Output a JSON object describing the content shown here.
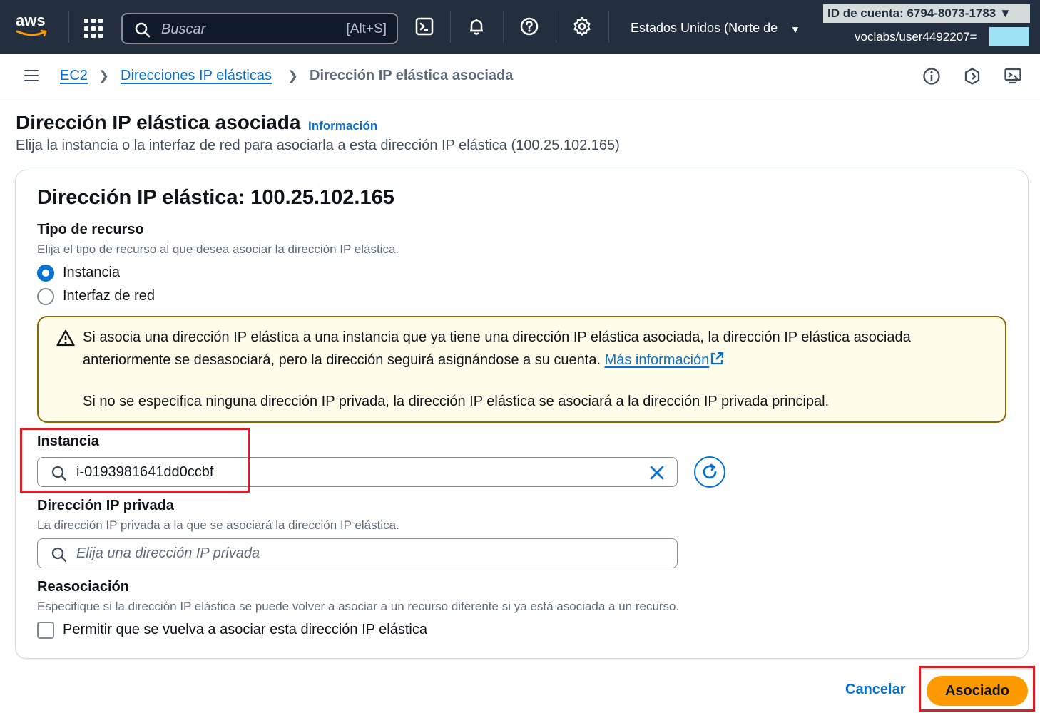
{
  "nav": {
    "logo": "aws",
    "search_placeholder": "Buscar",
    "search_shortcut": "[Alt+S]",
    "region": "Estados Unidos (Norte de",
    "account_id": "ID de cuenta: 6794-8073-1783 ▼",
    "user": "voclabs/user4492207="
  },
  "breadcrumb": {
    "items": [
      {
        "label": "EC2"
      },
      {
        "label": "Direcciones IP elásticas"
      },
      {
        "label": "Dirección IP elástica asociada"
      }
    ]
  },
  "header": {
    "title": "Dirección IP elástica asociada",
    "info": "Información",
    "subtitle": "Elija la instancia o la interfaz de red para asociarla a esta dirección IP elástica (100.25.102.165)"
  },
  "panel": {
    "title": "Dirección IP elástica: 100.25.102.165",
    "resource_type": {
      "label": "Tipo de recurso",
      "description": "Elija el tipo de recurso al que desea asociar la dirección IP elástica.",
      "options": [
        {
          "label": "Instancia",
          "selected": true
        },
        {
          "label": "Interfaz de red",
          "selected": false
        }
      ]
    },
    "alert": {
      "line1": "Si asocia una dirección IP elástica a una instancia que ya tiene una dirección IP elástica asociada, la dirección IP elástica asociada",
      "line2": "anteriormente se desasociará, pero la dirección seguirá asignándose a su cuenta.",
      "link": "Más información",
      "line3": "Si no se especifica ninguna dirección IP privada, la dirección IP elástica se asociará a la dirección IP privada principal."
    },
    "instance": {
      "label": "Instancia",
      "value": "i-0193981641dd0ccbf"
    },
    "private_ip": {
      "label": "Dirección IP privada",
      "description": "La dirección IP privada a la que se asociará la dirección IP elástica.",
      "placeholder": "Elija una dirección IP privada"
    },
    "reassociation": {
      "label": "Reasociación",
      "description": "Especifique si la dirección IP elástica se puede volver a asociar a un recurso diferente si ya está asociada a un recurso.",
      "checkbox_label": "Permitir que se vuelva a asociar esta dirección IP elástica",
      "checked": false
    }
  },
  "actions": {
    "cancel": "Cancelar",
    "submit": "Asociado"
  },
  "colors": {
    "nav_bg": "#232f3e",
    "link": "#0972d3",
    "primary": "#ff9900",
    "alert_bg": "#fffce9",
    "alert_border": "#8d6605",
    "highlight": "#e31b23"
  }
}
